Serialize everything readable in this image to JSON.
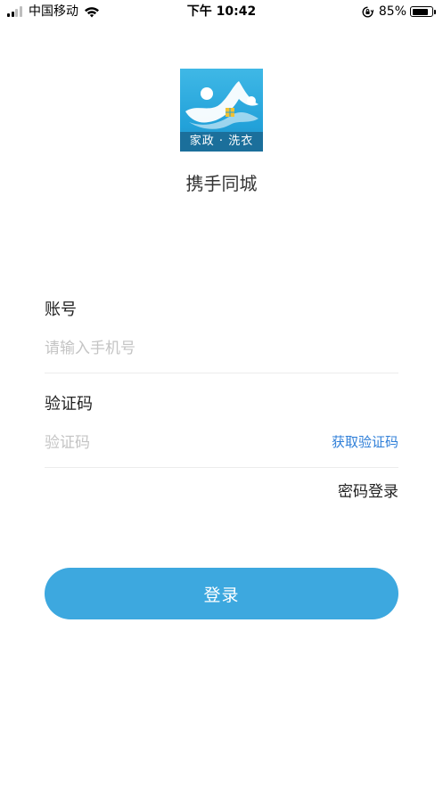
{
  "status_bar": {
    "carrier": "中国移动",
    "time": "下午 10:42",
    "battery_percent": "85%",
    "battery_level": 0.85,
    "icons": [
      "signal-icon",
      "wifi-icon",
      "rotation-lock-icon",
      "battery-icon"
    ]
  },
  "logo": {
    "text": "家政 · 洗衣",
    "colors": {
      "background": "#22a1d9",
      "band": "#1b6f9b",
      "window": "#f2c232"
    }
  },
  "app_name": "携手同城",
  "form": {
    "account_label": "账号",
    "account_placeholder": "请输入手机号",
    "code_label": "验证码",
    "code_placeholder": "验证码",
    "get_code": "获取验证码",
    "password_login": "密码登录"
  },
  "login_button": "登录",
  "colors": {
    "accent": "#3da8df",
    "link": "#2f7fd8"
  }
}
